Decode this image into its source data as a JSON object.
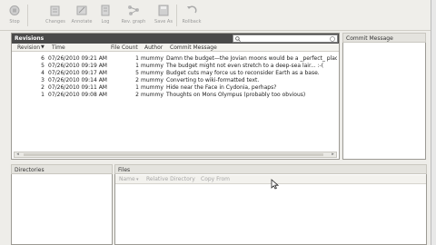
{
  "toolbar": {
    "buttons": [
      {
        "label": "Stop",
        "icon": "stop-icon"
      },
      {
        "label": "Changes",
        "icon": "changes-icon"
      },
      {
        "label": "Annotate",
        "icon": "annotate-icon"
      },
      {
        "label": "Log",
        "icon": "log-icon"
      },
      {
        "label": "Rev. graph",
        "icon": "revision-graph-icon"
      },
      {
        "label": "Save As",
        "icon": "save-as-icon"
      },
      {
        "label": "Rollback",
        "icon": "rollback-icon"
      }
    ]
  },
  "revisions": {
    "title": "Revisions",
    "search_value": "",
    "columns": [
      "Revision",
      "Time",
      "File Count",
      "Author",
      "Commit Message"
    ],
    "rows": [
      {
        "revision": "6",
        "time": "07/26/2010 09:21 AM",
        "file_count": "1",
        "author": "mummy",
        "message": "Damn the budget—the Jovian moons would be a _perfect_ place"
      },
      {
        "revision": "5",
        "time": "07/26/2010 09:19 AM",
        "file_count": "1",
        "author": "mummy",
        "message": "The budget might not even stretch to a deep-sea lair... :-("
      },
      {
        "revision": "4",
        "time": "07/26/2010 09:17 AM",
        "file_count": "5",
        "author": "mummy",
        "message": "Budget cuts may force us to reconsider Earth as a base."
      },
      {
        "revision": "3",
        "time": "07/26/2010 09:14 AM",
        "file_count": "2",
        "author": "mummy",
        "message": "Converting to wiki-formatted text."
      },
      {
        "revision": "2",
        "time": "07/26/2010 09:11 AM",
        "file_count": "1",
        "author": "mummy",
        "message": "Hide near the Face in Cydonia, perhaps?"
      },
      {
        "revision": "1",
        "time": "07/26/2010 09:08 AM",
        "file_count": "2",
        "author": "mummy",
        "message": "Thoughts on Mons Olympus (probably too obvious)"
      }
    ]
  },
  "commit": {
    "title": "Commit Message"
  },
  "directories": {
    "title": "Directories"
  },
  "files": {
    "title": "Files",
    "toolbar": {
      "name": "Name",
      "relative_directory": "Relative Directory",
      "copy_from": "Copy From"
    }
  }
}
